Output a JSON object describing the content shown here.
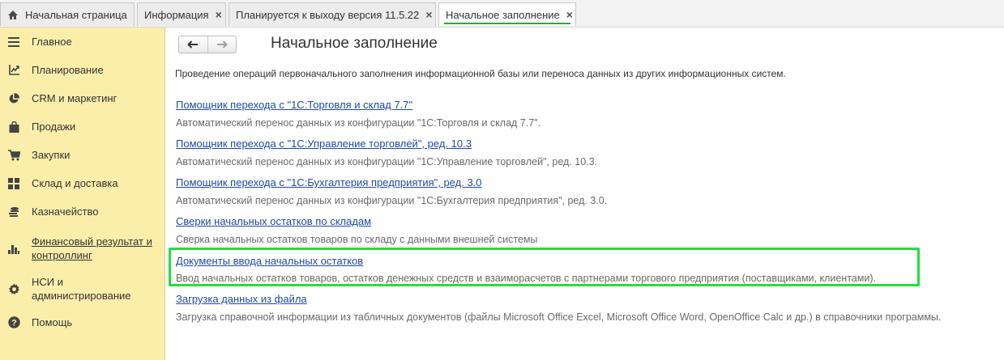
{
  "tabs": [
    {
      "label": "Начальная страница",
      "icon": "home-icon",
      "closable": false
    },
    {
      "label": "Информация",
      "closable": true
    },
    {
      "label": "Планируется к выходу версия 11.5.22",
      "closable": true
    },
    {
      "label": "Начальное заполнение",
      "closable": true,
      "active": true
    }
  ],
  "close_glyph": "×",
  "sidebar": {
    "items": [
      {
        "label": "Главное",
        "icon": "menu-icon"
      },
      {
        "label": "Планирование",
        "icon": "planning-icon"
      },
      {
        "label": "CRM и маркетинг",
        "icon": "pie-chart-icon"
      },
      {
        "label": "Продажи",
        "icon": "shopping-bag-icon"
      },
      {
        "label": "Закупки",
        "icon": "cart-icon"
      },
      {
        "label": "Склад и доставка",
        "icon": "warehouse-grid-icon"
      },
      {
        "label": "Казначейство",
        "icon": "coins-icon"
      },
      {
        "label_line1": "Финансовый результат и",
        "label_line2": "контроллинг",
        "icon": "bar-chart-icon"
      },
      {
        "label_line1": "НСИ и",
        "label_line2": "администрирование",
        "icon": "gear-icon"
      },
      {
        "label": "Помощь",
        "icon": "help-icon"
      }
    ]
  },
  "main": {
    "title": "Начальное заполнение",
    "description": "Проведение операций первоначального заполнения информационной базы или переноса данных из других информационных систем.",
    "entries": [
      {
        "link": "Помощник перехода с \"1С:Торговля и склад 7.7\"",
        "text": "Автоматический перенос данных из конфигурации \"1С:Торговля и склад 7.7\"."
      },
      {
        "link": "Помощник перехода с \"1С:Управление торговлей\", ред. 10.3",
        "text": "Автоматический перенос данных из конфигурации \"1С:Управление торговлей\", ред. 10.3."
      },
      {
        "link": "Помощник перехода с \"1С:Бухгалтерия предприятия\", ред. 3.0",
        "text": "Автоматический перенос данных из конфигурации \"1С:Бухгалтерия предприятия\", ред. 3.0."
      },
      {
        "link": "Сверки начальных остатков по складам",
        "text": "Сверка начальных остатков товаров по складу с данными внешней системы"
      },
      {
        "link": "Документы ввода начальных остатков",
        "text": "Ввод начальных остатков товаров, остатков денежных средств и взаиморасчетов с партнерами торгового предприятия (поставщиками, клиентами).",
        "highlighted": true
      },
      {
        "link": "Загрузка данных из файла",
        "text": "Загрузка справочной информации из табличных документов (файлы Microsoft Office Excel, Microsoft Office Word, OpenOffice Calc и др.) в справочники программы."
      }
    ]
  },
  "colors": {
    "sidebar_bg": "#fbeeaa",
    "link": "#1f4aa8",
    "highlight": "#22e03a",
    "active_tab_underline": "#2aa640"
  }
}
